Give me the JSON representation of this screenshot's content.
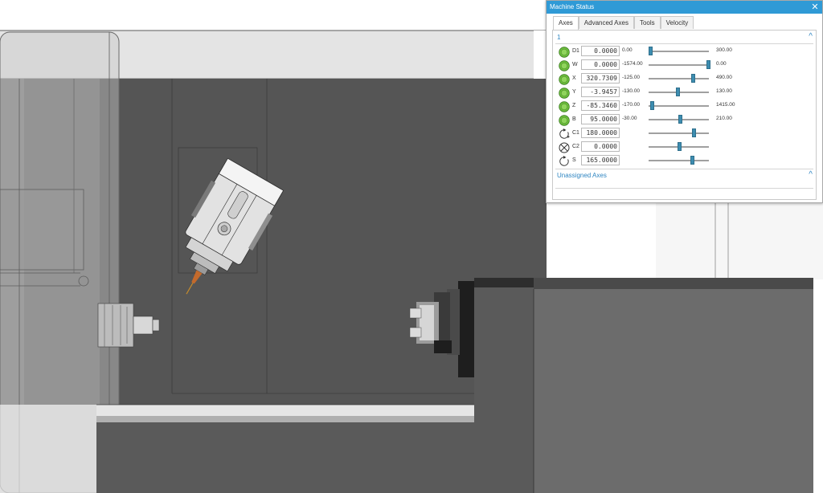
{
  "window": {
    "title": "Machine Status",
    "close_glyph": "✕"
  },
  "tabs": [
    {
      "label": "Axes",
      "active": true
    },
    {
      "label": "Advanced Axes",
      "active": false
    },
    {
      "label": "Tools",
      "active": false
    },
    {
      "label": "Velocity",
      "active": false
    }
  ],
  "groups": [
    {
      "label": "1",
      "chevron": "^"
    },
    {
      "label": "Unassigned Axes",
      "chevron": "^"
    }
  ],
  "axes": [
    {
      "name": "D1",
      "value": "0.0000",
      "min": "0.00",
      "max": "300.00",
      "fraction": 0.02,
      "icon": "linear-axis-icon"
    },
    {
      "name": "W",
      "value": "0.0000",
      "min": "-1574.00",
      "max": "0.00",
      "fraction": 0.98,
      "icon": "linear-axis-icon"
    },
    {
      "name": "X",
      "value": "320.7309",
      "min": "-125.00",
      "max": "490.00",
      "fraction": 0.73,
      "icon": "linear-axis-icon"
    },
    {
      "name": "Y",
      "value": "-3.9457",
      "min": "-130.00",
      "max": "130.00",
      "fraction": 0.48,
      "icon": "linear-axis-icon"
    },
    {
      "name": "Z",
      "value": "-85.3460",
      "min": "-170.00",
      "max": "1415.00",
      "fraction": 0.05,
      "icon": "linear-axis-icon"
    },
    {
      "name": "B",
      "value": "95.0000",
      "min": "-30.00",
      "max": "210.00",
      "fraction": 0.52,
      "icon": "linear-axis-icon"
    },
    {
      "name": "C1",
      "value": "180.0000",
      "min": "",
      "max": "",
      "fraction": 0.75,
      "icon": "rotary-axis-icon"
    },
    {
      "name": "C2",
      "value": "0.0000",
      "min": "",
      "max": "",
      "fraction": 0.5,
      "icon": "locked-axis-icon"
    },
    {
      "name": "S",
      "value": "165.0000",
      "min": "",
      "max": "",
      "fraction": 0.72,
      "icon": "spindle-axis-icon"
    }
  ],
  "colors": {
    "titlebar": "#2f9ad6",
    "accent_text": "#2f86c2",
    "slider_thumb": "#3d8db0",
    "axis_icon_green": "#6cbf3c",
    "viewport_dark": "#555555"
  }
}
